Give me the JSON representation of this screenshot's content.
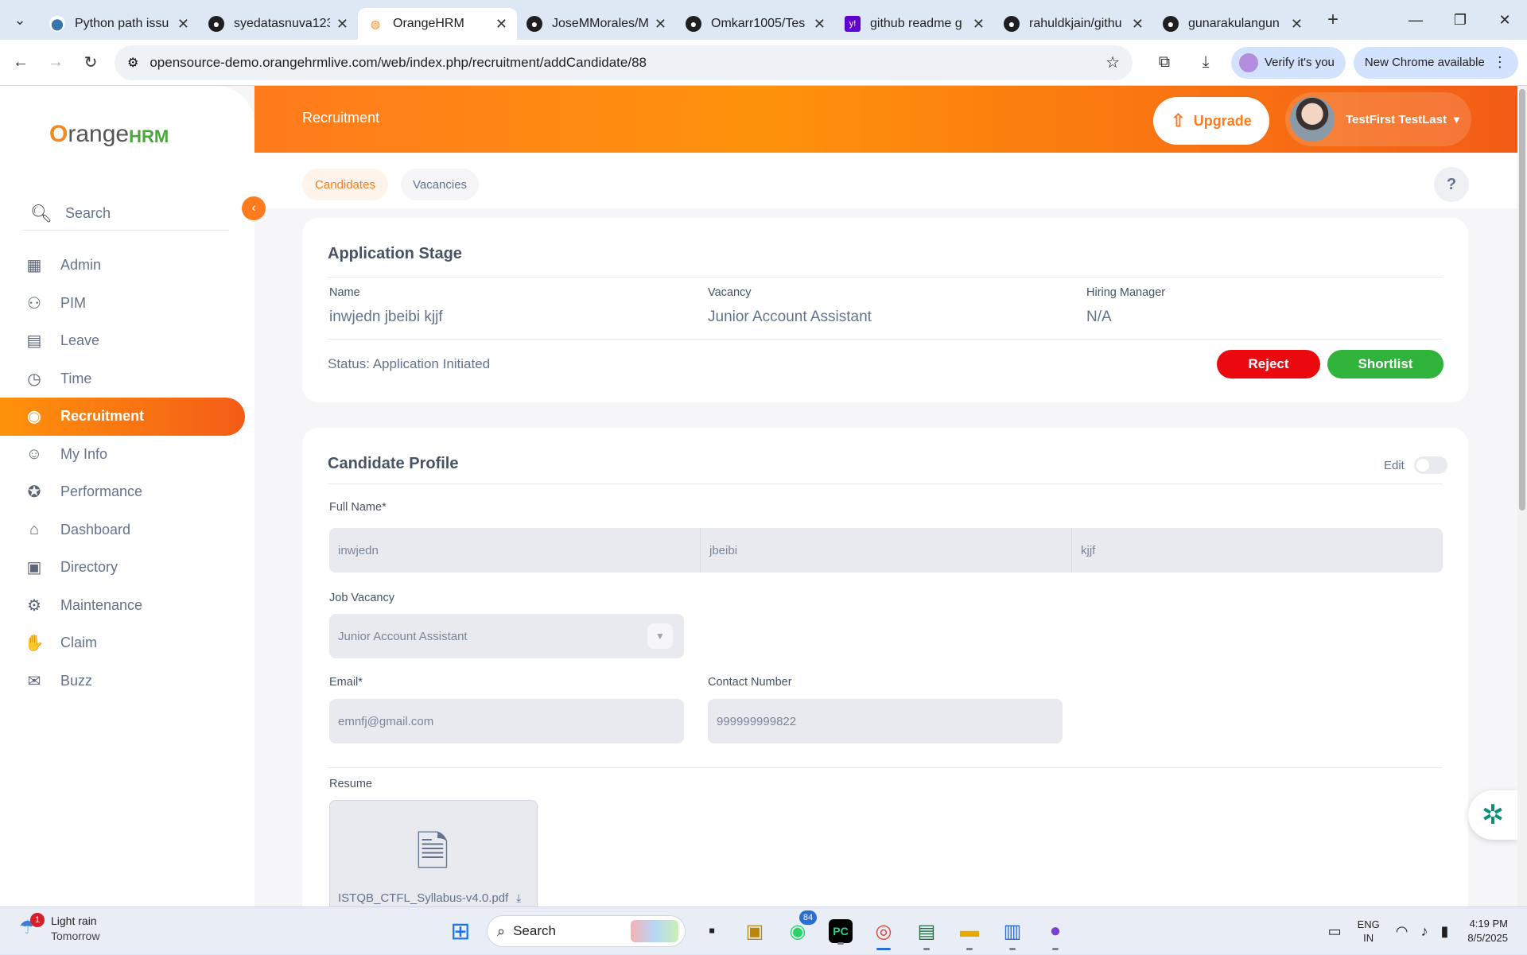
{
  "browser": {
    "tabs": [
      {
        "title": "Python path issu",
        "icon": "python-icon",
        "active": false
      },
      {
        "title": "syedatasnuva123",
        "icon": "github-icon",
        "active": false
      },
      {
        "title": "OrangeHRM",
        "icon": "orangehrm-icon",
        "active": true
      },
      {
        "title": "JoseMMorales/M",
        "icon": "github-icon",
        "active": false
      },
      {
        "title": "Omkarr1005/Tes",
        "icon": "github-icon",
        "active": false
      },
      {
        "title": "github readme g",
        "icon": "yahoo-icon",
        "active": false
      },
      {
        "title": "rahuldkjain/githu",
        "icon": "github-icon",
        "active": false
      },
      {
        "title": "gunarakulangun",
        "icon": "github-icon",
        "active": false
      }
    ],
    "url": "opensource-demo.orangehrmlive.com/web/index.php/recruitment/addCandidate/88",
    "verify_label": "Verify it's you",
    "new_chrome_label": "New Chrome available"
  },
  "app": {
    "logo_o": "O",
    "logo_range": "range",
    "logo_hrm": "HRM",
    "search_placeholder": "Search",
    "menu": [
      {
        "label": "Admin",
        "icon": "admin-icon"
      },
      {
        "label": "PIM",
        "icon": "pim-icon"
      },
      {
        "label": "Leave",
        "icon": "leave-icon"
      },
      {
        "label": "Time",
        "icon": "time-icon"
      },
      {
        "label": "Recruitment",
        "icon": "recruitment-icon",
        "active": true
      },
      {
        "label": "My Info",
        "icon": "myinfo-icon"
      },
      {
        "label": "Performance",
        "icon": "performance-icon"
      },
      {
        "label": "Dashboard",
        "icon": "dashboard-icon"
      },
      {
        "label": "Directory",
        "icon": "directory-icon"
      },
      {
        "label": "Maintenance",
        "icon": "maintenance-icon"
      },
      {
        "label": "Claim",
        "icon": "claim-icon"
      },
      {
        "label": "Buzz",
        "icon": "buzz-icon"
      }
    ],
    "page_title": "Recruitment",
    "upgrade_label": "Upgrade",
    "user_name": "TestFirst TestLast",
    "subtabs": {
      "candidates": "Candidates",
      "vacancies": "Vacancies"
    },
    "help_label": "?",
    "accent_color": "#ff7b1d"
  },
  "application_stage": {
    "title": "Application Stage",
    "name_label": "Name",
    "name_value": "inwjedn jbeibi kjjf",
    "vacancy_label": "Vacancy",
    "vacancy_value": "Junior Account Assistant",
    "manager_label": "Hiring Manager",
    "manager_value": "N/A",
    "status": "Status: Application Initiated",
    "reject_label": "Reject",
    "shortlist_label": "Shortlist"
  },
  "candidate_profile": {
    "title": "Candidate Profile",
    "edit_label": "Edit",
    "full_name_label": "Full Name*",
    "first_name": "inwjedn",
    "middle_name": "jbeibi",
    "last_name": "kjjf",
    "job_vacancy_label": "Job Vacancy",
    "job_vacancy_value": "Junior Account Assistant",
    "email_label": "Email*",
    "email_value": "emnfj@gmail.com",
    "contact_label": "Contact Number",
    "contact_value": "999999999822",
    "resume_label": "Resume",
    "resume_file": "ISTQB_CTFL_Syllabus-v4.0.pdf"
  },
  "taskbar": {
    "weather_title": "Light rain",
    "weather_sub": "Tomorrow",
    "weather_badge": "1",
    "search_label": "Search",
    "whatsapp_badge": "84",
    "lang_top": "ENG",
    "lang_bottom": "IN",
    "time": "4:19 PM",
    "date": "8/5/2025"
  }
}
